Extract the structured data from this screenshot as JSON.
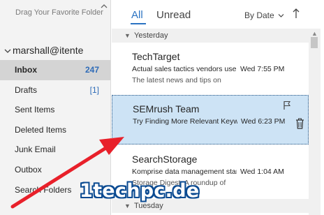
{
  "folder_pane": {
    "favorites_hint": "Drag Your Favorite Folder",
    "account": "marshall@itente",
    "folders": [
      {
        "label": "Inbox",
        "count": "247",
        "selected": true
      },
      {
        "label": "Drafts",
        "count": "[1]",
        "selected": false
      },
      {
        "label": "Sent Items",
        "count": "",
        "selected": false
      },
      {
        "label": "Deleted Items",
        "count": "",
        "selected": false
      },
      {
        "label": "Junk Email",
        "count": "",
        "selected": false
      },
      {
        "label": "Outbox",
        "count": "",
        "selected": false
      },
      {
        "label": "Search Folders",
        "count": "",
        "selected": false
      }
    ]
  },
  "list_pane": {
    "tabs": {
      "all": "All",
      "unread": "Unread"
    },
    "sort_label": "By Date",
    "groups": {
      "yesterday": "Yesterday",
      "tuesday": "Tuesday"
    },
    "messages": [
      {
        "sender": "TechTarget",
        "subject": "Actual sales tactics vendors use",
        "time": "Wed 7:55 PM",
        "preview": "The latest news and tips on"
      },
      {
        "sender": "SEMrush Team",
        "subject": "Try Finding More Relevant Keywords",
        "time": "Wed 6:23 PM",
        "preview": ""
      },
      {
        "sender": "SearchStorage",
        "subject": "Komprise data management startup",
        "time": "Wed 1:04 AM",
        "preview": "Storage Digest: A roundup of"
      }
    ]
  },
  "icons": {
    "collapse": "chevron-up-icon",
    "flag": "flag-icon",
    "delete": "trash-icon",
    "sort_direction": "arrow-up-icon"
  },
  "colors": {
    "accent": "#2b73c2",
    "selected_message": "#cde3f5",
    "selected_folder": "#d4d4d4",
    "annotation_arrow": "#e8202a"
  },
  "watermark": "1techpc.de"
}
